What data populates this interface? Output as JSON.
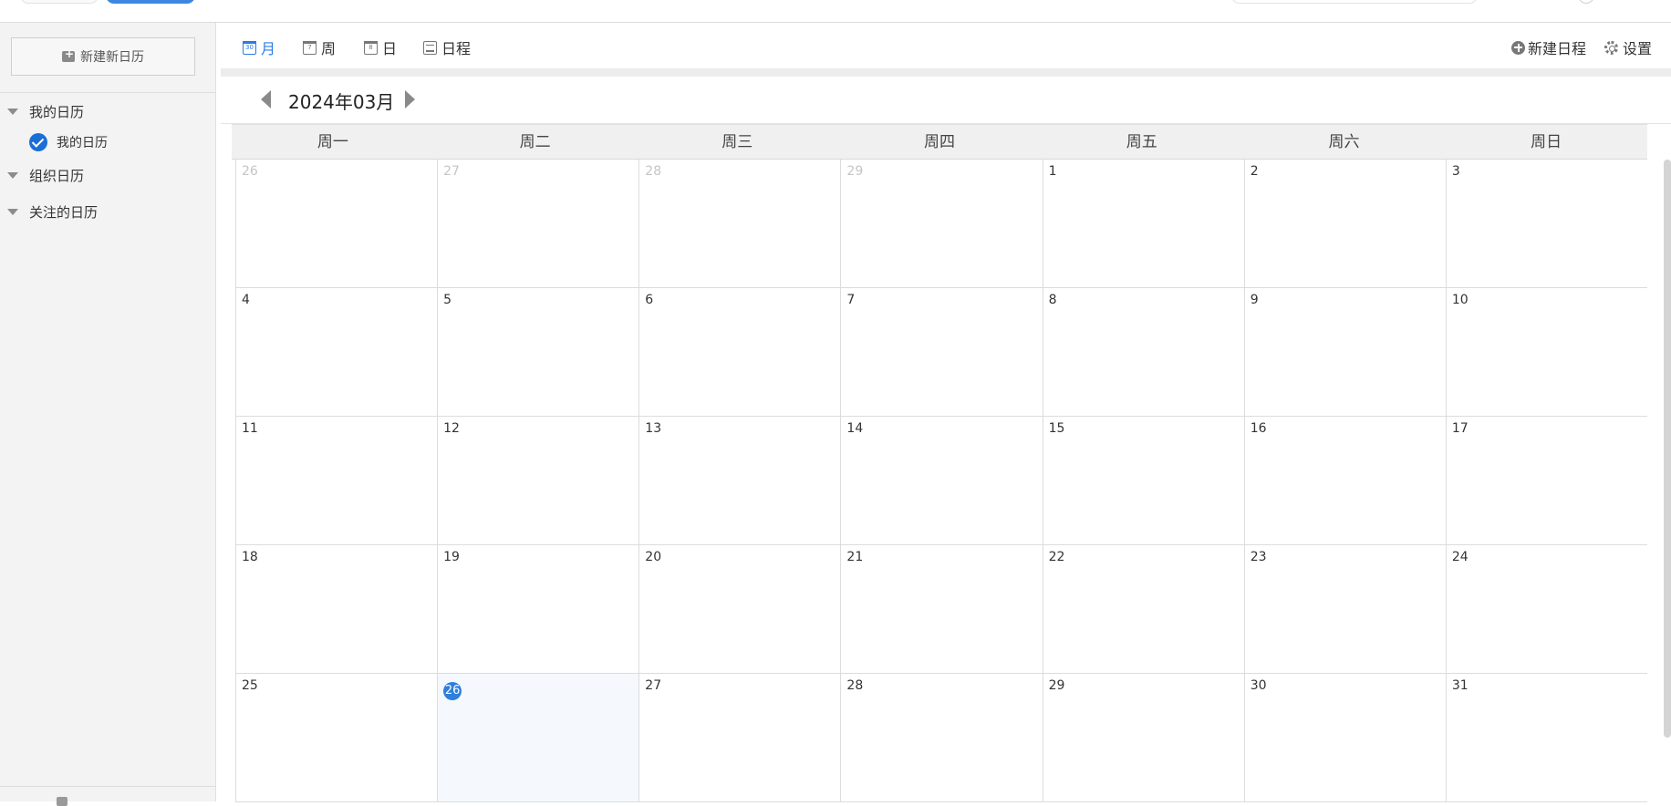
{
  "sidebar": {
    "new_calendar_label": "新建新日历",
    "groups": [
      "我的日历",
      "组织日历",
      "关注的日历"
    ],
    "my_calendar_item": "我的日历"
  },
  "toolbar": {
    "views": [
      {
        "label": "月",
        "icon": "calendar-month-icon",
        "icon_text": "30",
        "active": true
      },
      {
        "label": "周",
        "icon": "calendar-week-icon",
        "icon_text": "7",
        "active": false
      },
      {
        "label": "日",
        "icon": "calendar-day-icon",
        "icon_text": "8",
        "active": false
      },
      {
        "label": "日程",
        "icon": "schedule-list-icon",
        "icon_text": "",
        "active": false
      }
    ],
    "new_event_label": "新建日程",
    "settings_label": "设置"
  },
  "month_nav": {
    "title": "2024年03月"
  },
  "weekdays": [
    "周一",
    "周二",
    "周三",
    "周四",
    "周五",
    "周六",
    "周日"
  ],
  "weeks": [
    [
      {
        "d": "26",
        "other": true
      },
      {
        "d": "27",
        "other": true
      },
      {
        "d": "28",
        "other": true
      },
      {
        "d": "29",
        "other": true
      },
      {
        "d": "1"
      },
      {
        "d": "2"
      },
      {
        "d": "3"
      }
    ],
    [
      {
        "d": "4"
      },
      {
        "d": "5"
      },
      {
        "d": "6"
      },
      {
        "d": "7"
      },
      {
        "d": "8"
      },
      {
        "d": "9"
      },
      {
        "d": "10"
      }
    ],
    [
      {
        "d": "11"
      },
      {
        "d": "12"
      },
      {
        "d": "13"
      },
      {
        "d": "14"
      },
      {
        "d": "15"
      },
      {
        "d": "16"
      },
      {
        "d": "17"
      }
    ],
    [
      {
        "d": "18"
      },
      {
        "d": "19"
      },
      {
        "d": "20"
      },
      {
        "d": "21"
      },
      {
        "d": "22"
      },
      {
        "d": "23"
      },
      {
        "d": "24"
      }
    ],
    [
      {
        "d": "25"
      },
      {
        "d": "26",
        "today": true
      },
      {
        "d": "27"
      },
      {
        "d": "28"
      },
      {
        "d": "29"
      },
      {
        "d": "30"
      },
      {
        "d": "31"
      }
    ]
  ],
  "colors": {
    "accent": "#2c7be5",
    "today_badge": "#2e7fde",
    "check": "#1a6fd6"
  }
}
